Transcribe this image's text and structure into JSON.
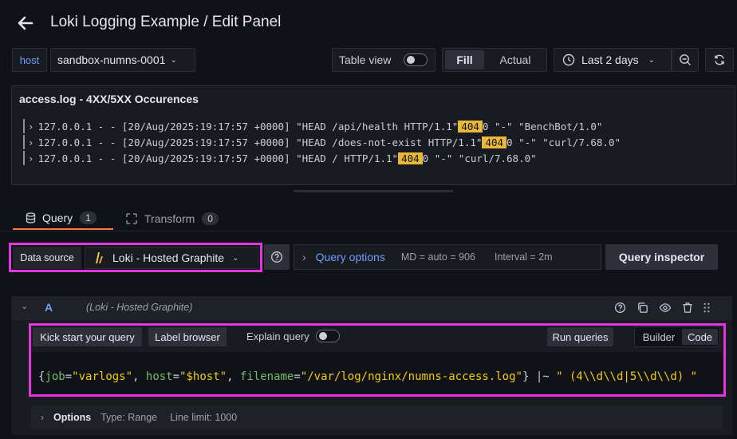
{
  "header": {
    "title": "Loki Logging Example / Edit Panel"
  },
  "toolbar": {
    "variable_label": "host",
    "variable_value": "sandbox-numns-0001",
    "table_view_label": "Table view",
    "fill_label": "Fill",
    "actual_label": "Actual",
    "time_range": "Last 2 days"
  },
  "panel": {
    "title": "access.log - 4XX/5XX Occurences",
    "logs": [
      {
        "pre": "127.0.0.1 - - [20/Aug/2025:19:17:57 +0000] \"HEAD /api/health HTTP/1.1\"",
        "highlight": "404",
        "post": "0 \"-\" \"BenchBot/1.0\""
      },
      {
        "pre": "127.0.0.1 - - [20/Aug/2025:19:17:57 +0000] \"HEAD /does-not-exist HTTP/1.1\"",
        "highlight": "404",
        "post": "0 \"-\" \"curl/7.68.0\""
      },
      {
        "pre": "127.0.0.1 - - [20/Aug/2025:19:17:57 +0000] \"HEAD / HTTP/1.1\"",
        "highlight": "404",
        "post": "0 \"-\" \"curl/7.68.0\""
      }
    ]
  },
  "tabs": [
    {
      "label": "Query",
      "count": "1"
    },
    {
      "label": "Transform",
      "count": "0"
    }
  ],
  "query_bar": {
    "data_source_label": "Data source",
    "data_source_value": "Loki - Hosted Graphite",
    "query_options_label": "Query options",
    "md_info": "MD = auto = 906",
    "interval_info": "Interval = 2m",
    "query_inspector_label": "Query inspector"
  },
  "query_row": {
    "letter": "A",
    "source": "(Loki - Hosted Graphite)"
  },
  "editor": {
    "kick_start_label": "Kick start your query",
    "label_browser_label": "Label browser",
    "explain_query_label": "Explain query",
    "run_queries_label": "Run queries",
    "builder_label": "Builder",
    "code_label": "Code",
    "query_parts": {
      "open": "{",
      "k1": "job",
      "eq1": "=",
      "v1": "\"varlogs\"",
      "c1": ", ",
      "k2": "host",
      "eq2": "=",
      "v2": "\"$host\"",
      "c2": ", ",
      "k3": "filename",
      "eq3": "=",
      "v3": "\"/var/log/nginx/numns-access.log\"",
      "close": "}",
      "op": " |~ ",
      "regex": "\" (4\\\\d\\\\d|5\\\\d\\\\d) \""
    }
  },
  "options": {
    "label": "Options",
    "type": "Type: Range",
    "line_limit": "Line limit: 1000"
  },
  "colors": {
    "highlight": "#eab839",
    "magenta": "#e535e0",
    "link_blue": "#6e9fff",
    "tab_accent": "#f97c3b"
  }
}
